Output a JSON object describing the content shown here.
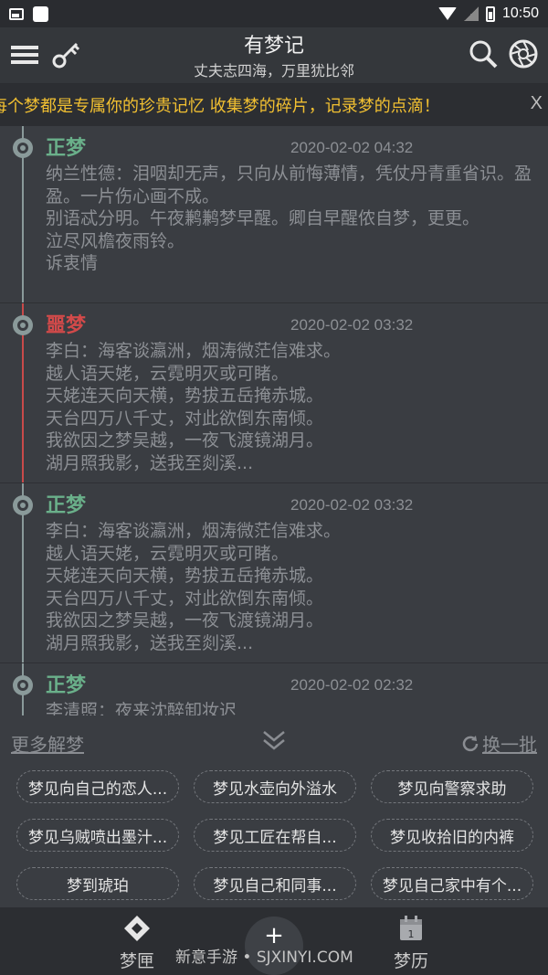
{
  "status_bar": {
    "time": "10:50"
  },
  "header": {
    "title": "有梦记",
    "subtitle": "丈夫志四海，万里犹比邻"
  },
  "marquee": {
    "text": "每个梦都是专属你的珍贵记忆 收集梦的碎片，记录梦的点滴！",
    "close": "X"
  },
  "entries": [
    {
      "type": "正梦",
      "kind": "good",
      "date": "2020-02-02 04:32",
      "lines": [
        "纳兰性德：泪咽却无声，只向从前悔薄情，凭仗丹青重省识。盈盈。一片伤心画不成。",
        "别语忒分明。午夜鹣鹣梦早醒。卿自早醒侬自梦，更更。",
        "泣尽风檐夜雨铃。",
        "诉衷情"
      ]
    },
    {
      "type": "噩梦",
      "kind": "bad",
      "date": "2020-02-02 03:32",
      "lines": [
        "李白：海客谈瀛洲，烟涛微茫信难求。",
        "越人语天姥，云霓明灭或可睹。",
        "天姥连天向天横，势拔五岳掩赤城。",
        "天台四万八千丈，对此欲倒东南倾。",
        "我欲因之梦吴越，一夜飞渡镜湖月。",
        "湖月照我影，送我至剡溪..."
      ]
    },
    {
      "type": "正梦",
      "kind": "good",
      "date": "2020-02-02 03:32",
      "lines": [
        "李白：海客谈瀛洲，烟涛微茫信难求。",
        "越人语天姥，云霓明灭或可睹。",
        "天姥连天向天横，势拔五岳掩赤城。",
        "天台四万八千丈，对此欲倒东南倾。",
        "我欲因之梦吴越，一夜飞渡镜湖月。",
        "湖月照我影，送我至剡溪..."
      ]
    },
    {
      "type": "正梦",
      "kind": "good",
      "date": "2020-02-02 02:32",
      "lines": [
        "李清照：夜来沈醉卸妆迟"
      ]
    }
  ],
  "more": {
    "link": "更多解梦",
    "refresh": "换一批",
    "chips": [
      "梦见向自己的恋人...",
      "梦见水壶向外溢水",
      "梦见向警察求助",
      "梦见乌贼喷出墨汁...",
      "梦见工匠在帮自...",
      "梦见收拾旧的内裤",
      "梦到琥珀",
      "梦见自己和同事...",
      "梦见自己家中有个..."
    ]
  },
  "bottom_nav": {
    "home_label": "梦匣",
    "calendar_label": "梦历",
    "calendar_day": "1",
    "fab": "+",
    "watermark": "新意手游 • SJXINYI.COM"
  },
  "colors": {
    "good": "#6ab08a",
    "bad": "#d34a4a",
    "marquee": "#f2c031"
  }
}
